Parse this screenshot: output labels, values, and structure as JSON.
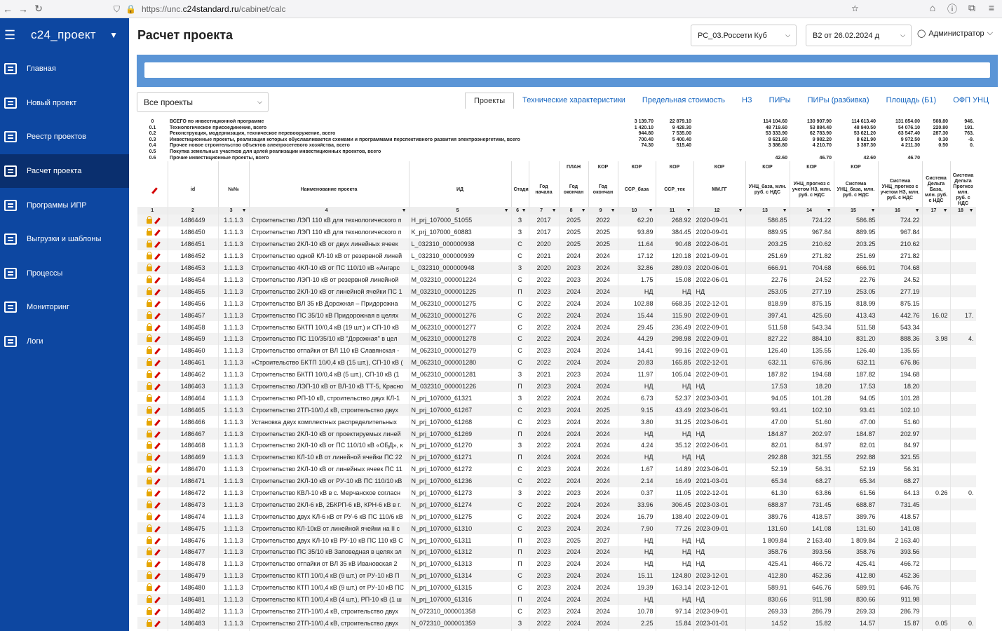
{
  "browser": {
    "url_prefix": "https://unc.",
    "url_host": "c24standard.ru",
    "url_path": "/cabinet/calc"
  },
  "sidebar": {
    "brand": "c24_проект",
    "items": [
      "Главная",
      "Новый проект",
      "Реестр проектов",
      "Расчет проекта",
      "Программы ИПР",
      "Выгрузки и шаблоны",
      "Процессы",
      "Мониторинг",
      "Логи"
    ],
    "active": 3
  },
  "header": {
    "title": "Расчет проекта",
    "select1": "РС_03.Россети Куб",
    "select2": "В2 от 26.02.2024 д",
    "user": "Администратор"
  },
  "filter": {
    "value": "Все проекты"
  },
  "tabs": [
    "Проекты",
    "Технические характеристики",
    "Предельная стоимость",
    "НЗ",
    "ПИРы",
    "ПИРы (разбивка)",
    "Площадь (Б1)",
    "ОФП УНЦ"
  ],
  "summary": [
    [
      "0",
      "ВСЕГО по инвестиционной программе",
      "3 139.70",
      "22 879.10",
      "114 104.60",
      "130 907.90",
      "114 613.40",
      "131 854.00",
      "508.80",
      "946."
    ],
    [
      "0.1",
      "Технологическое присоединение, всего",
      "1 420.10",
      "9 428.30",
      "48 719.60",
      "53 884.40",
      "48 940.50",
      "54 076.10",
      "220.80",
      "191."
    ],
    [
      "0.2",
      "Реконструкция, модернизация, техническое перевооружение, всего",
      "944.80",
      "7 535.00",
      "53 333.90",
      "62 783.90",
      "53 621.20",
      "63 547.40",
      "287.30",
      "763."
    ],
    [
      "0.3",
      "Инвестиционные проекты, реализация которых обуславливается схемами и программами перспективного развития электроэнергетики, всего",
      "700.40",
      "5 400.40",
      "8 621.60",
      "9 982.20",
      "8 621.90",
      "9 972.50",
      "0.30",
      "-9."
    ],
    [
      "0.4",
      "Прочее новое строительство объектов электросетевого хозяйства, всего",
      "74.30",
      "515.40",
      "3 386.80",
      "4 210.70",
      "3 387.30",
      "4 211.30",
      "0.50",
      "0."
    ],
    [
      "0.5",
      "Покупка земельных участков для целей реализации инвестиционных проектов, всего",
      "",
      "",
      "",
      "",
      "",
      "",
      "",
      ""
    ],
    [
      "0.6",
      "Прочие инвестиционные проекты, всего",
      "",
      "",
      "42.60",
      "46.70",
      "42.60",
      "46.70",
      "",
      ""
    ]
  ],
  "top_labels": [
    "ПЛАН",
    "КОР",
    "КОР",
    "КОР",
    "КОР",
    "КОР",
    "КОР"
  ],
  "columns": [
    "id",
    "№№",
    "Наименование проекта",
    "ИД",
    "Стадия",
    "Год начала",
    "Год окончан",
    "Год окончан",
    "ССР_база",
    "ССР_тек",
    "ММ.ГГ",
    "УНЦ_база, млн. руб. с НДС",
    "УНЦ_прогноз с учетом НЗ, млн. руб. с НДС",
    "Система УНЦ_база, млн. руб. с НДС",
    "Система УНЦ_прогноз с учетом НЗ, млн. руб. с НДС",
    "Система Дельта База, млн. руб. с НДС",
    "Система Дельта Прогноз млн. руб. с НДС"
  ],
  "col_numbers": [
    "1",
    "2",
    "3",
    "4",
    "5",
    "6",
    "7",
    "8",
    "9",
    "10",
    "11",
    "12",
    "13",
    "14",
    "15",
    "16",
    "17",
    "18"
  ],
  "rows": [
    [
      "1486449",
      "1.1.1.3",
      "Строительство ЛЭП 110 кВ для технологического п",
      "H_prj_107000_51055",
      "З",
      "2017",
      "2025",
      "2022",
      "62.20",
      "268.92",
      "2020-09-01",
      "586.85",
      "724.22",
      "586.85",
      "724.22",
      "",
      ""
    ],
    [
      "1486450",
      "1.1.1.3",
      "Строительство ЛЭП 110 кВ для технологического п",
      "K_prj_107000_60883",
      "З",
      "2017",
      "2025",
      "2025",
      "93.89",
      "384.45",
      "2020-09-01",
      "889.95",
      "967.84",
      "889.95",
      "967.84",
      "",
      ""
    ],
    [
      "1486451",
      "1.1.1.3",
      "Строительство 2КЛ-10 кВ от двух линейных ячеек",
      "L_032310_000000938",
      "С",
      "2020",
      "2025",
      "2025",
      "11.64",
      "90.48",
      "2022-06-01",
      "203.25",
      "210.62",
      "203.25",
      "210.62",
      "",
      ""
    ],
    [
      "1486452",
      "1.1.1.3",
      "Строительство одной КЛ-10 кВ от резервной линей",
      "L_032310_000000939",
      "С",
      "2021",
      "2024",
      "2024",
      "17.12",
      "120.18",
      "2021-09-01",
      "251.69",
      "271.82",
      "251.69",
      "271.82",
      "",
      ""
    ],
    [
      "1486453",
      "1.1.1.3",
      "Строительство 4КЛ-10 кВ от ПС 110/10 кВ «Ангарс",
      "L_032310_000000948",
      "З",
      "2020",
      "2023",
      "2024",
      "32.86",
      "289.03",
      "2020-06-01",
      "666.91",
      "704.68",
      "666.91",
      "704.68",
      "",
      ""
    ],
    [
      "1486454",
      "1.1.1.3",
      "Строительство ЛЭП-10 кВ от резервной линейной",
      "M_032310_000001224",
      "С",
      "2022",
      "2023",
      "2024",
      "1.75",
      "15.08",
      "2022-06-01",
      "22.76",
      "24.52",
      "22.76",
      "24.52",
      "",
      ""
    ],
    [
      "1486455",
      "1.1.1.3",
      "Строительство 2КЛ-10 кВ от линейной ячейки ПС 1",
      "M_032310_000001225",
      "П",
      "2023",
      "2024",
      "2024",
      "НД",
      "НД",
      "НД",
      "253.05",
      "277.19",
      "253.05",
      "277.19",
      "",
      ""
    ],
    [
      "1486456",
      "1.1.1.3",
      "Строительство ВЛ 35 кВ Дорожная – Придорожна",
      "M_062310_000001275",
      "С",
      "2022",
      "2024",
      "2024",
      "102.88",
      "668.35",
      "2022-12-01",
      "818.99",
      "875.15",
      "818.99",
      "875.15",
      "",
      ""
    ],
    [
      "1486457",
      "1.1.1.3",
      "Строительство ПС 35/10 кВ Придорожная в целях",
      "M_062310_000001276",
      "С",
      "2022",
      "2024",
      "2024",
      "15.44",
      "115.90",
      "2022-09-01",
      "397.41",
      "425.60",
      "413.43",
      "442.76",
      "16.02",
      "17."
    ],
    [
      "1486458",
      "1.1.1.3",
      "Строительство БКТП 10/0,4 кВ (19 шт.) и СП-10 кВ",
      "M_062310_000001277",
      "С",
      "2022",
      "2024",
      "2024",
      "29.45",
      "236.49",
      "2022-09-01",
      "511.58",
      "543.34",
      "511.58",
      "543.34",
      "",
      ""
    ],
    [
      "1486459",
      "1.1.1.3",
      "Строительство ПС 110/35/10 кВ \"Дорожная\" в цел",
      "M_062310_000001278",
      "С",
      "2022",
      "2024",
      "2024",
      "44.29",
      "298.98",
      "2022-09-01",
      "827.22",
      "884.10",
      "831.20",
      "888.36",
      "3.98",
      "4."
    ],
    [
      "1486460",
      "1.1.1.3",
      "Строительство отпайки от ВЛ 110 кВ Славянская -",
      "M_062310_000001279",
      "С",
      "2023",
      "2024",
      "2024",
      "14.41",
      "99.16",
      "2022-09-01",
      "126.40",
      "135.55",
      "126.40",
      "135.55",
      "",
      ""
    ],
    [
      "1486461",
      "1.1.1.3",
      "«Строительство БКТП 10/0,4 кВ (15 шт.), СП-10 кВ (",
      "M_062310_000001280",
      "С",
      "2022",
      "2024",
      "2024",
      "20.83",
      "165.85",
      "2022-12-01",
      "632.11",
      "676.86",
      "632.11",
      "676.86",
      "",
      ""
    ],
    [
      "1486462",
      "1.1.1.3",
      "Строительство БКТП 10/0,4 кВ (5 шт.), СП-10 кВ (1",
      "M_062310_000001281",
      "З",
      "2021",
      "2023",
      "2024",
      "11.97",
      "105.04",
      "2022-09-01",
      "187.82",
      "194.68",
      "187.82",
      "194.68",
      "",
      ""
    ],
    [
      "1486463",
      "1.1.1.3",
      "Строительство ЛЭП-10 кВ от ВЛ-10 кВ ТТ-5, Красно",
      "M_032310_000001226",
      "П",
      "2023",
      "2024",
      "2024",
      "НД",
      "НД",
      "НД",
      "17.53",
      "18.20",
      "17.53",
      "18.20",
      "",
      ""
    ],
    [
      "1486464",
      "1.1.1.3",
      "Строительство РП-10 кВ, строительство двух КЛ-1",
      "N_prj_107000_61321",
      "З",
      "2022",
      "2024",
      "2024",
      "6.73",
      "52.37",
      "2023-03-01",
      "94.05",
      "101.28",
      "94.05",
      "101.28",
      "",
      ""
    ],
    [
      "1486465",
      "1.1.1.3",
      "Строительство 2ТП-10/0,4 кВ, строительство двух",
      "N_prj_107000_61267",
      "С",
      "2023",
      "2024",
      "2025",
      "9.15",
      "43.49",
      "2023-06-01",
      "93.41",
      "102.10",
      "93.41",
      "102.10",
      "",
      ""
    ],
    [
      "1486466",
      "1.1.1.3",
      "Установка двух комплектных распределительных",
      "N_prj_107000_61268",
      "С",
      "2023",
      "2024",
      "2024",
      "3.80",
      "31.25",
      "2023-06-01",
      "47.00",
      "51.60",
      "47.00",
      "51.60",
      "",
      ""
    ],
    [
      "1486467",
      "1.1.1.3",
      "Строительство 2КЛ-10 кВ от проектируемых линей",
      "N_prj_107000_61269",
      "П",
      "2024",
      "2024",
      "2024",
      "НД",
      "НД",
      "НД",
      "184.87",
      "202.97",
      "184.87",
      "202.97",
      "",
      ""
    ],
    [
      "1486468",
      "1.1.1.3",
      "Строительство 2КЛ-10 кВ от ПС 110/10 кВ «ОБД», к",
      "N_prj_107000_61270",
      "З",
      "2022",
      "2024",
      "2024",
      "4.24",
      "35.12",
      "2022-06-01",
      "82.01",
      "84.97",
      "82.01",
      "84.97",
      "",
      ""
    ],
    [
      "1486469",
      "1.1.1.3",
      "Строительство КЛ-10 кВ от линейной ячейки ПС 22",
      "N_prj_107000_61271",
      "П",
      "2024",
      "2024",
      "2024",
      "НД",
      "НД",
      "НД",
      "292.88",
      "321.55",
      "292.88",
      "321.55",
      "",
      ""
    ],
    [
      "1486470",
      "1.1.1.3",
      "Строительство 2КЛ-10 кВ от линейных ячеек ПС 11",
      "N_prj_107000_61272",
      "С",
      "2023",
      "2024",
      "2024",
      "1.67",
      "14.89",
      "2023-06-01",
      "52.19",
      "56.31",
      "52.19",
      "56.31",
      "",
      ""
    ],
    [
      "1486471",
      "1.1.1.3",
      "Строительство 2КЛ-10 кВ от РУ-10 кВ ПС 110/10 кВ",
      "N_prj_107000_61236",
      "С",
      "2022",
      "2024",
      "2024",
      "2.14",
      "16.49",
      "2021-03-01",
      "65.34",
      "68.27",
      "65.34",
      "68.27",
      "",
      ""
    ],
    [
      "1486472",
      "1.1.1.3",
      "Строительство КВЛ-10 кВ в с. Мерчанское согласн",
      "N_prj_107000_61273",
      "З",
      "2022",
      "2023",
      "2024",
      "0.37",
      "11.05",
      "2022-12-01",
      "61.30",
      "63.86",
      "61.56",
      "64.13",
      "0.26",
      "0."
    ],
    [
      "1486473",
      "1.1.1.3",
      "Строительство 2КЛ-6 кВ, 2БКРП-6 кВ, КРН-6 кВ в г.",
      "N_prj_107000_61274",
      "С",
      "2022",
      "2024",
      "2024",
      "33.96",
      "306.45",
      "2023-03-01",
      "688.87",
      "731.45",
      "688.87",
      "731.45",
      "",
      ""
    ],
    [
      "1486474",
      "1.1.1.3",
      "Строительство двух КЛ-6 кВ от РУ-6 кВ ПС 110/6 кВ",
      "N_prj_107000_61275",
      "С",
      "2022",
      "2024",
      "2024",
      "16.79",
      "138.40",
      "2022-09-01",
      "389.76",
      "418.57",
      "389.76",
      "418.57",
      "",
      ""
    ],
    [
      "1486475",
      "1.1.1.3",
      "Строительство КЛ-10кВ от линейной ячейки на II с",
      "N_prj_107000_61310",
      "С",
      "2023",
      "2024",
      "2024",
      "7.90",
      "77.26",
      "2023-09-01",
      "131.60",
      "141.08",
      "131.60",
      "141.08",
      "",
      ""
    ],
    [
      "1486476",
      "1.1.1.3",
      "Строительство двух КЛ-10 кВ РУ-10 кВ ПС 110 кВ С",
      "N_prj_107000_61311",
      "П",
      "2023",
      "2025",
      "2027",
      "НД",
      "НД",
      "НД",
      "1 809.84",
      "2 163.40",
      "1 809.84",
      "2 163.40",
      "",
      ""
    ],
    [
      "1486477",
      "1.1.1.3",
      "Строительство ПС 35/10 кВ Заповедная в целях эл",
      "N_prj_107000_61312",
      "П",
      "2023",
      "2024",
      "2024",
      "НД",
      "НД",
      "НД",
      "358.76",
      "393.56",
      "358.76",
      "393.56",
      "",
      ""
    ],
    [
      "1486478",
      "1.1.1.3",
      "Строительство отпайки от ВЛ 35 кВ Ивановская 2",
      "N_prj_107000_61313",
      "П",
      "2023",
      "2024",
      "2024",
      "НД",
      "НД",
      "НД",
      "425.41",
      "466.72",
      "425.41",
      "466.72",
      "",
      ""
    ],
    [
      "1486479",
      "1.1.1.3",
      "Строительство КТП 10/0,4 кВ (9 шт.) от РУ-10 кВ П",
      "N_prj_107000_61314",
      "С",
      "2023",
      "2024",
      "2024",
      "15.11",
      "124.80",
      "2023-12-01",
      "412.80",
      "452.36",
      "412.80",
      "452.36",
      "",
      ""
    ],
    [
      "1486480",
      "1.1.1.3",
      "Строительство КТП 10/0,4 кВ (9 шт.) от РУ-10 кВ ПС",
      "N_prj_107000_61315",
      "С",
      "2023",
      "2024",
      "2024",
      "19.39",
      "163.14",
      "2023-12-01",
      "589.91",
      "646.76",
      "589.91",
      "646.76",
      "",
      ""
    ],
    [
      "1486481",
      "1.1.1.3",
      "Строительство КТП 10/0,4 кВ (4 шт.), РП-10 кВ (1 ш",
      "N_prj_107000_61316",
      "П",
      "2024",
      "2024",
      "2024",
      "НД",
      "НД",
      "НД",
      "830.66",
      "911.98",
      "830.66",
      "911.98",
      "",
      ""
    ],
    [
      "1486482",
      "1.1.1.3",
      "Строительство 2ТП-10/0,4 кВ, строительство двух",
      "N_072310_000001358",
      "С",
      "2023",
      "2024",
      "2024",
      "10.78",
      "97.14",
      "2023-09-01",
      "269.33",
      "286.79",
      "269.33",
      "286.79",
      "",
      ""
    ],
    [
      "1486483",
      "1.1.1.3",
      "Строительство 2ТП-10/0,4 кВ, строительство двух",
      "N_072310_000001359",
      "З",
      "2022",
      "2024",
      "2024",
      "2.25",
      "15.84",
      "2023-01-01",
      "14.52",
      "15.82",
      "14.57",
      "15.87",
      "0.05",
      "0."
    ],
    [
      "1486484",
      "1.1.1.3",
      "Строительство ЛЭП-10 кВ от ВЛ-10 кВ ВЦ-7, с устан",
      "N_032310_000001360",
      "С",
      "2023",
      "2024",
      "2024",
      "0.66",
      "4.80",
      "2023-03-01",
      "5.90",
      "6.16",
      "5.90",
      "6.16",
      "",
      ""
    ]
  ]
}
